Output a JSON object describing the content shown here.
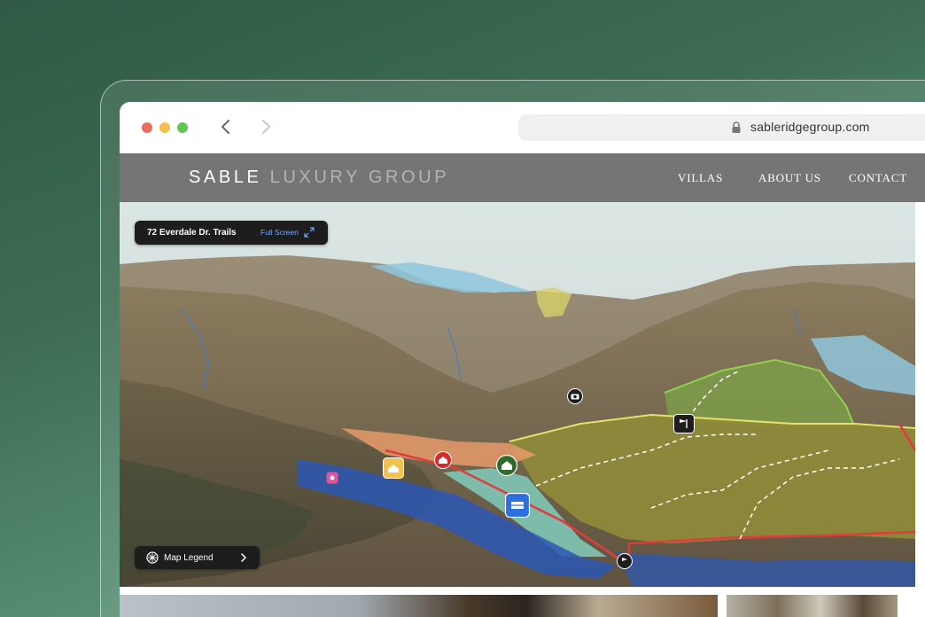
{
  "browser": {
    "url": "sableridgegroup.com"
  },
  "site": {
    "brand_primary": "SABLE",
    "brand_secondary": "LUXURY GROUP",
    "nav": {
      "villas": "VILLAS",
      "about": "ABOUT US",
      "contact": "CONTACT"
    }
  },
  "map": {
    "trail_title": "72 Everdale Dr. Trails",
    "fullscreen_label": "Full Screen",
    "legend_label": "Map Legend",
    "markers": [
      {
        "icon": "camera-icon",
        "color": "#1d1d1d"
      },
      {
        "icon": "flag-icon",
        "color": "#1d1d1d"
      },
      {
        "icon": "house-icon",
        "color": "#2f6b2f"
      },
      {
        "icon": "barn-icon",
        "color": "#d52b2b"
      },
      {
        "icon": "cabin-icon",
        "color": "#f2c14e"
      },
      {
        "icon": "fence-icon",
        "color": "#2e6fe0"
      },
      {
        "icon": "flag-icon",
        "color": "#1d1d1d"
      },
      {
        "icon": "pin-icon",
        "color": "#e0559b"
      }
    ]
  },
  "colors": {
    "page_bg": "#3d6b52",
    "nav_bar": "#757575",
    "link_blue": "#6fa8ff"
  }
}
